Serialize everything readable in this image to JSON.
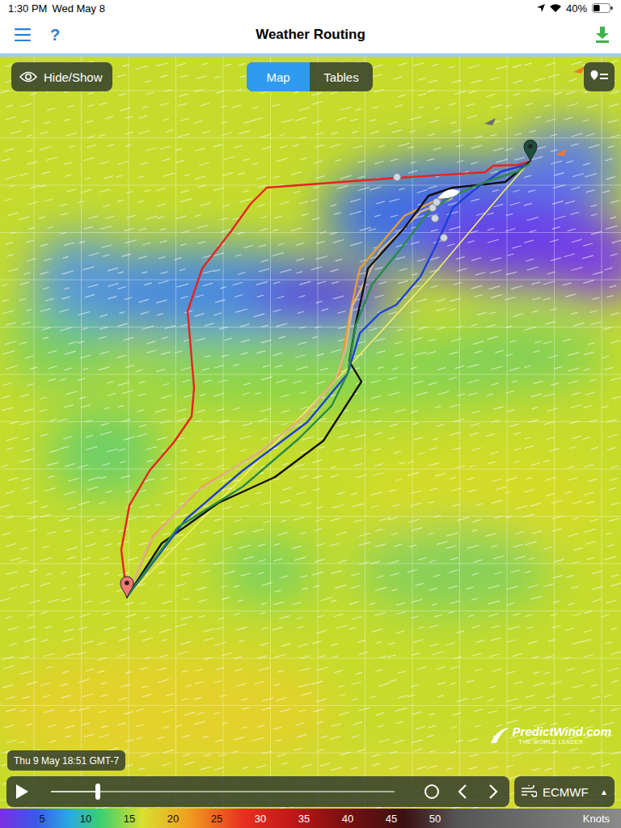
{
  "status_bar": {
    "time": "1:30 PM",
    "date": "Wed May 8",
    "battery": "40%",
    "battery_level": 0.4
  },
  "nav_bar": {
    "help": "?",
    "title": "Weather Routing"
  },
  "hide_show": {
    "label": "Hide/Show"
  },
  "tabs": [
    {
      "label": "Map",
      "selected": true
    },
    {
      "label": "Tables",
      "selected": false
    }
  ],
  "map": {
    "routes": [
      {
        "color": "#e8231f",
        "points": [
          [
            157,
            738
          ],
          [
            150,
            680
          ],
          [
            160,
            625
          ],
          [
            185,
            582
          ],
          [
            215,
            547
          ],
          [
            237,
            515
          ],
          [
            240,
            480
          ],
          [
            235,
            420
          ],
          [
            232,
            385
          ],
          [
            250,
            332
          ],
          [
            285,
            287
          ],
          [
            310,
            252
          ],
          [
            330,
            232
          ],
          [
            490,
            220
          ],
          [
            600,
            213
          ],
          [
            610,
            205
          ],
          [
            640,
            204
          ],
          [
            655,
            200
          ]
        ]
      },
      {
        "color": "#f2ee6a",
        "points": [
          [
            157,
            738
          ],
          [
            300,
            590
          ],
          [
            430,
            455
          ],
          [
            540,
            335
          ],
          [
            620,
            240
          ],
          [
            655,
            200
          ]
        ]
      },
      {
        "color": "#e8a030",
        "points": [
          [
            157,
            738
          ],
          [
            190,
            662
          ],
          [
            250,
            602
          ],
          [
            320,
            560
          ],
          [
            380,
            512
          ],
          [
            420,
            462
          ],
          [
            432,
            392
          ],
          [
            445,
            332
          ],
          [
            500,
            267
          ],
          [
            540,
            247
          ],
          [
            560,
            240
          ]
        ]
      },
      {
        "color": "#d8b890",
        "points": [
          [
            157,
            738
          ],
          [
            185,
            670
          ],
          [
            240,
            610
          ],
          [
            310,
            566
          ],
          [
            372,
            520
          ],
          [
            415,
            470
          ],
          [
            428,
            430
          ],
          [
            436,
            378
          ],
          [
            470,
            310
          ],
          [
            520,
            262
          ],
          [
            560,
            245
          ]
        ]
      },
      {
        "color": "#111111",
        "points": [
          [
            157,
            738
          ],
          [
            200,
            672
          ],
          [
            270,
            622
          ],
          [
            340,
            590
          ],
          [
            400,
            545
          ],
          [
            447,
            472
          ],
          [
            432,
            447
          ],
          [
            440,
            400
          ],
          [
            455,
            332
          ],
          [
            500,
            282
          ],
          [
            530,
            242
          ],
          [
            560,
            232
          ],
          [
            600,
            228
          ],
          [
            625,
            225
          ],
          [
            655,
            200
          ]
        ]
      },
      {
        "color": "#1f3fd8",
        "points": [
          [
            157,
            738
          ],
          [
            230,
            642
          ],
          [
            300,
            582
          ],
          [
            380,
            522
          ],
          [
            430,
            462
          ],
          [
            445,
            412
          ],
          [
            470,
            387
          ],
          [
            490,
            377
          ],
          [
            520,
            342
          ],
          [
            540,
            302
          ],
          [
            560,
            257
          ],
          [
            590,
            232
          ],
          [
            620,
            212
          ],
          [
            650,
            204
          ]
        ]
      },
      {
        "color": "#2a8a4a",
        "points": [
          [
            157,
            738
          ],
          [
            220,
            652
          ],
          [
            300,
            602
          ],
          [
            370,
            542
          ],
          [
            410,
            502
          ],
          [
            430,
            462
          ],
          [
            440,
            402
          ],
          [
            460,
            352
          ],
          [
            500,
            302
          ],
          [
            530,
            262
          ],
          [
            560,
            242
          ],
          [
            600,
            225
          ],
          [
            640,
            212
          ],
          [
            655,
            202
          ]
        ]
      }
    ],
    "waypoints": [
      [
        491,
        219
      ],
      [
        535,
        257
      ],
      [
        538,
        270
      ],
      [
        540,
        250
      ],
      [
        549,
        294
      ]
    ],
    "start": {
      "point": [
        157,
        740
      ],
      "color": "#f07a74"
    },
    "finish": {
      "point": [
        656,
        200
      ],
      "color": "#1f4d3f"
    },
    "boat": [
      555,
      240
    ],
    "vessels": [
      {
        "point": [
          606,
          150
        ],
        "color": "#6d6d6d"
      },
      {
        "point": [
          694,
          188
        ],
        "color": "#f07a2a"
      },
      {
        "point": [
          716,
          86
        ],
        "color": "#f07a2a"
      }
    ]
  },
  "logo": {
    "brand": "PredictWind.com",
    "tagline": "THE WORLD LEADER"
  },
  "timestamp": "Thu 9 May 18:51 GMT-7",
  "playback": {
    "level": 0.136
  },
  "model": {
    "label": "ECMWF",
    "arrow": "▲"
  },
  "scale": {
    "ticks": [
      "5",
      "10",
      "15",
      "20",
      "25",
      "30",
      "35",
      "40",
      "45",
      "50"
    ],
    "unit": "Knots"
  }
}
